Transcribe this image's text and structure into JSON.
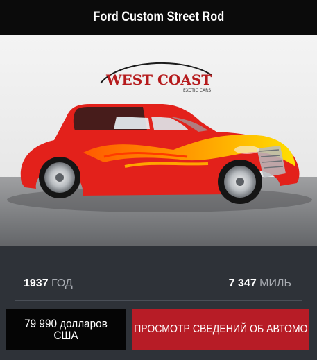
{
  "listing": {
    "title": "Ford Custom Street Rod",
    "logo_text": "WEST COAST",
    "logo_subtext": "EXOTIC CARS",
    "year_value": "1937",
    "year_unit": "ГОД",
    "mileage_value": "7 347",
    "mileage_unit": "МИЛЬ",
    "price": "79 990 долларов США",
    "cta_label": "ПРОСМОТР СВЕДЕНИЙ ОБ АВТОМО"
  },
  "colors": {
    "title_bg": "#0b0b0b",
    "card_bg": "#2e3238",
    "price_bg": "#050505",
    "cta_bg": "#b71c26",
    "car_body": "#e3211b"
  }
}
